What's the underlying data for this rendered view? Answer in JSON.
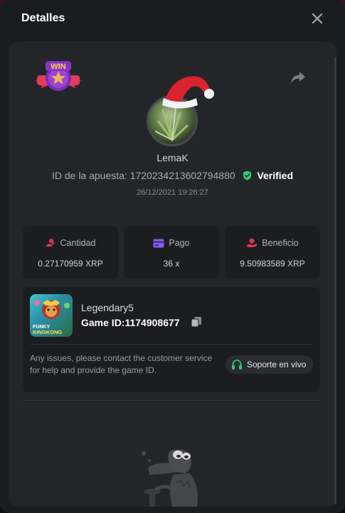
{
  "modal": {
    "title": "Detalles",
    "close_icon": "close-icon"
  },
  "profile": {
    "badge_text": "WIN",
    "username": "LemaK",
    "bet_id_label": "ID de la apuesta:",
    "bet_id": "1720234213602794880",
    "verified_label": "Verified",
    "date": "26/12/2021 19:26:27"
  },
  "stats": {
    "amount": {
      "label": "Cantidad",
      "value": "0.27170959 XRP",
      "icon": "coin-hand-icon"
    },
    "payout": {
      "label": "Pago",
      "value": "36 x",
      "icon": "card-icon"
    },
    "profit": {
      "label": "Beneficio",
      "value": "9.50983589 XRP",
      "icon": "profit-hand-icon"
    }
  },
  "game": {
    "name": "Legendary5",
    "id_label": "Game ID:",
    "id_value": "1174908677",
    "thumb_text": "FUNKY KINGKONG",
    "help_text": "Any issues, please contact the customer service for help and provide the game ID.",
    "support_label": "Soporte en vivo"
  },
  "colors": {
    "accent_green": "#2ecc71",
    "accent_red": "#e0394b",
    "accent_purple": "#8b5cf6"
  }
}
